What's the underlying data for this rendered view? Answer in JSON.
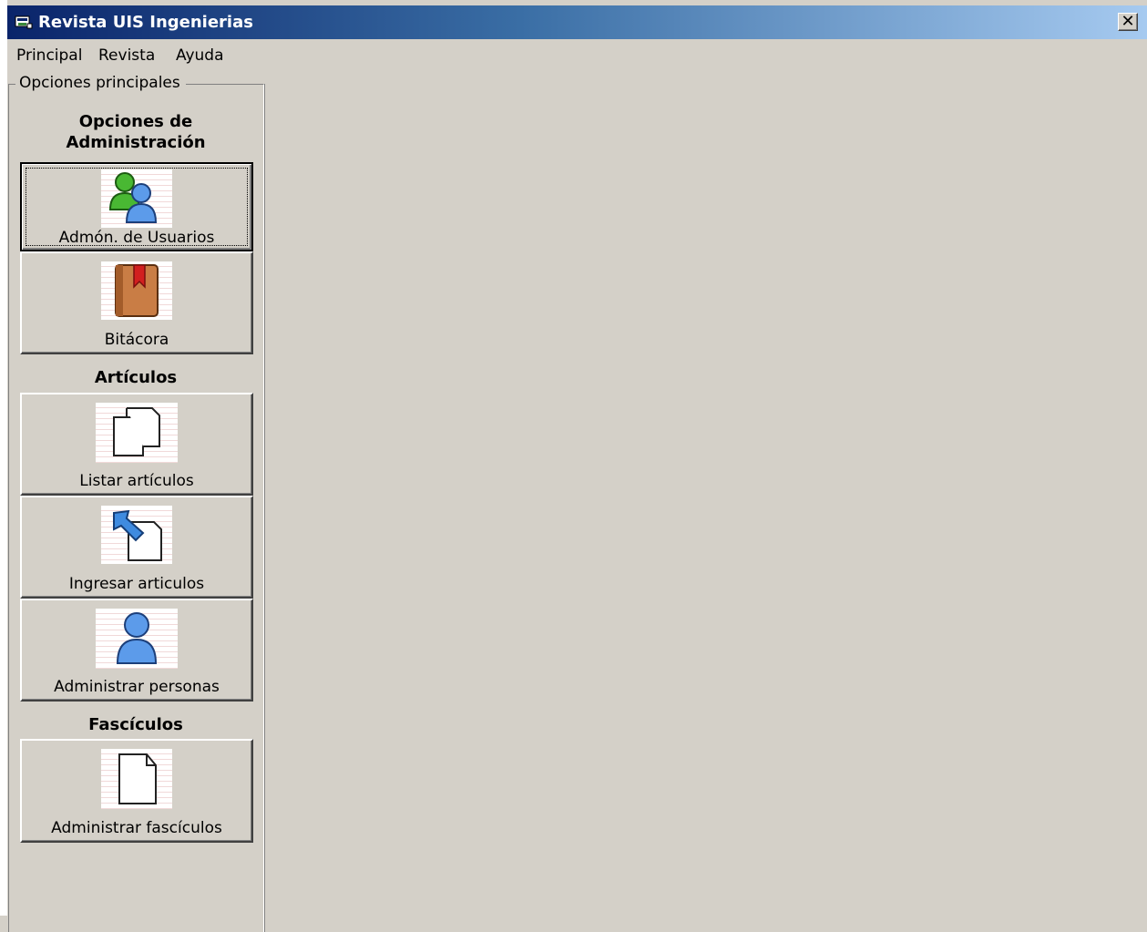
{
  "window": {
    "title": "Revista UIS Ingenierias",
    "close_glyph": "✕",
    "colors": {
      "titlebar_start": "#0a246a",
      "titlebar_end": "#a6caf0",
      "face": "#d4d0c8"
    }
  },
  "menu": {
    "items": [
      {
        "label": "Principal"
      },
      {
        "label": "Revista"
      },
      {
        "label": "Ayuda"
      }
    ]
  },
  "panel": {
    "legend": "Opciones principales",
    "sections": [
      {
        "heading": "Opciones de\nAdministración",
        "tiles": [
          {
            "label": "Admón. de Usuarios",
            "icon": "users-icon",
            "focused": true
          },
          {
            "label": "Bitácora",
            "icon": "book-icon",
            "focused": false
          }
        ]
      },
      {
        "heading": "Artículos",
        "tiles": [
          {
            "label": "Listar artículos",
            "icon": "documents-icon",
            "focused": false
          },
          {
            "label": "Ingresar articulos",
            "icon": "import-document-icon",
            "focused": false
          },
          {
            "label": "Administrar personas",
            "icon": "person-icon",
            "focused": false
          }
        ]
      },
      {
        "heading": "Fascículos",
        "tiles": [
          {
            "label": "Administrar fascículos",
            "icon": "document-icon",
            "focused": false
          }
        ]
      }
    ]
  }
}
